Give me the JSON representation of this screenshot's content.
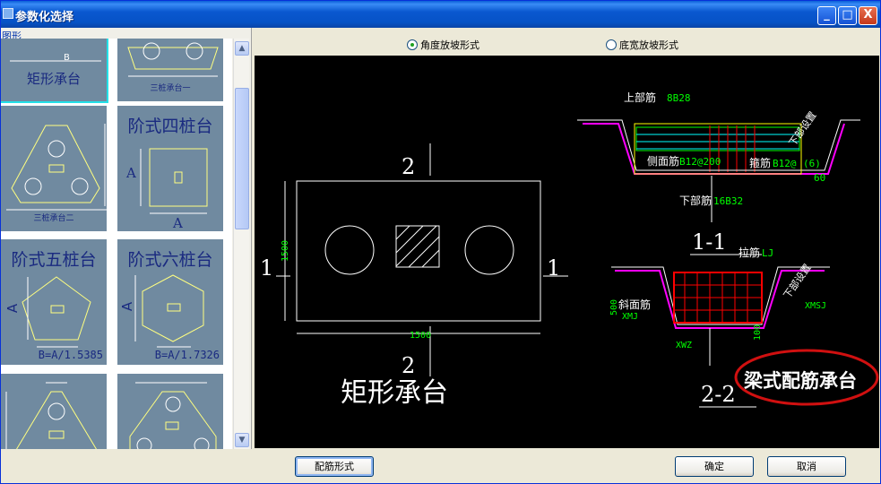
{
  "window": {
    "title": "参数化选择"
  },
  "titlebar_buttons": {
    "minimize": "_",
    "maximize": "□",
    "close": "X"
  },
  "left": {
    "label": "图形",
    "thumbnails": [
      {
        "title": "矩形承台",
        "caption": "B"
      },
      {
        "title": "",
        "caption": "三桩承台一"
      },
      {
        "title": "",
        "caption": "三桩承台二"
      },
      {
        "title": "阶式四桩台",
        "formula": "",
        "dim_a": "A"
      },
      {
        "title": "阶式五桩台",
        "formula": "B=A/1.5385",
        "dim_a": "A"
      },
      {
        "title": "阶式六桩台",
        "formula": "B=A/1.7326",
        "dim_a": "A"
      },
      {
        "title": ""
      },
      {
        "title": ""
      }
    ]
  },
  "options": {
    "radio1": "角度放坡形式",
    "radio2": "底宽放坡形式",
    "selected": "radio1"
  },
  "drawing": {
    "section_mark_2": "2",
    "section_mark_1": "1",
    "dim_1500_h": "1500",
    "dim_1500_v": "1500",
    "main_title": "矩形承台",
    "top_bar_label": "上部筋",
    "top_bar_value": "8B28",
    "side_bar_label": "侧面筋",
    "side_bar_value": "B12@200",
    "stirrup_label": "箍筋",
    "stirrup_value": "B12@",
    "stirrup_suffix": "(6)",
    "bottom_bar_label": "下部筋",
    "bottom_bar_value": "16B32",
    "angle": "60",
    "slope_note": "下部设置",
    "section_11": "1-1",
    "tie_label": "拉筋",
    "tie_value": "LJ",
    "slope_bar_label": "斜面筋",
    "slope_bar_value": "XMJ",
    "xmsj": "XMSJ",
    "xwz": "XWZ",
    "dim_500": "500",
    "dim_100": "100",
    "section_22": "2-2",
    "highlight_label": "梁式配筋承台"
  },
  "bottom": {
    "rebar_button": "配筋形式",
    "ok_button": "确定",
    "cancel_button": "取消"
  },
  "colors": {
    "canvas_bg": "#000000",
    "cad_green": "#00ff00",
    "cad_yellow": "#ffff00",
    "cad_red": "#ff0000",
    "cad_magenta": "#ff00ff",
    "highlight_ellipse": "#d01010"
  }
}
